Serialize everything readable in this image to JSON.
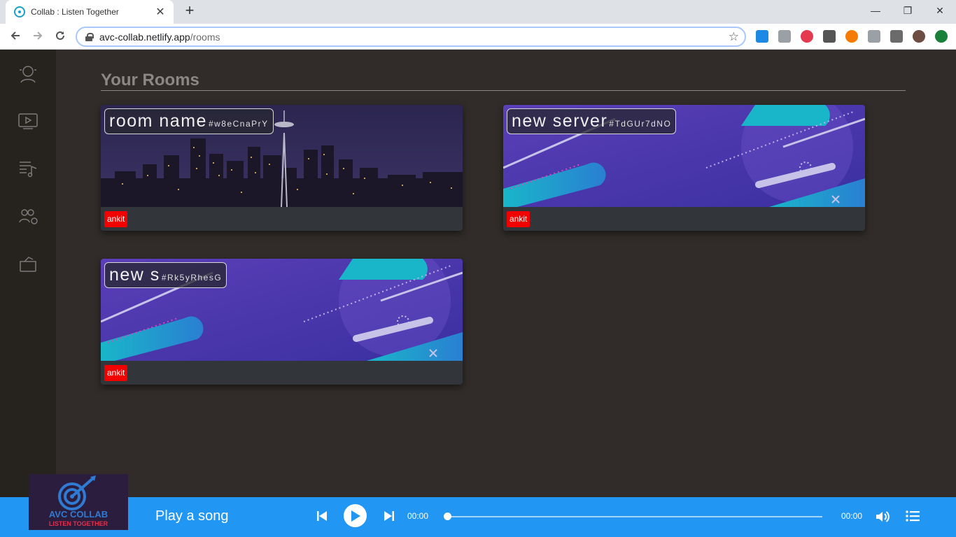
{
  "browser": {
    "tab_title": "Collab : Listen Together",
    "tab_close": "✕",
    "new_tab": "+",
    "url_host": "avc-collab.netlify.app",
    "url_path": "/rooms",
    "window_controls": {
      "minimize": "—",
      "restore": "❐",
      "close": "✕"
    }
  },
  "page": {
    "title": "Your Rooms"
  },
  "rooms": [
    {
      "name": "room name",
      "code": "#w8eCnaPrY",
      "owner": "ankit"
    },
    {
      "name": "new server",
      "code": "#TdGUr7dNO",
      "owner": "ankit"
    },
    {
      "name": "new s",
      "code": "#Rk5yRhesG",
      "owner": "ankit"
    }
  ],
  "sidebar": {
    "items": [
      "profile-icon",
      "video-icon",
      "playlist-icon",
      "users-icon",
      "room-icon"
    ]
  },
  "player": {
    "logo_line1": "AVC COLLAB",
    "logo_line2": "LISTEN TOGETHER",
    "song_label": "Play a song",
    "time_current": "00:00",
    "time_total": "00:00",
    "progress": 0
  },
  "colors": {
    "accent": "#2196f3",
    "owner_badge": "#f20000",
    "background": "#312c29",
    "sidebar": "#26231f"
  }
}
